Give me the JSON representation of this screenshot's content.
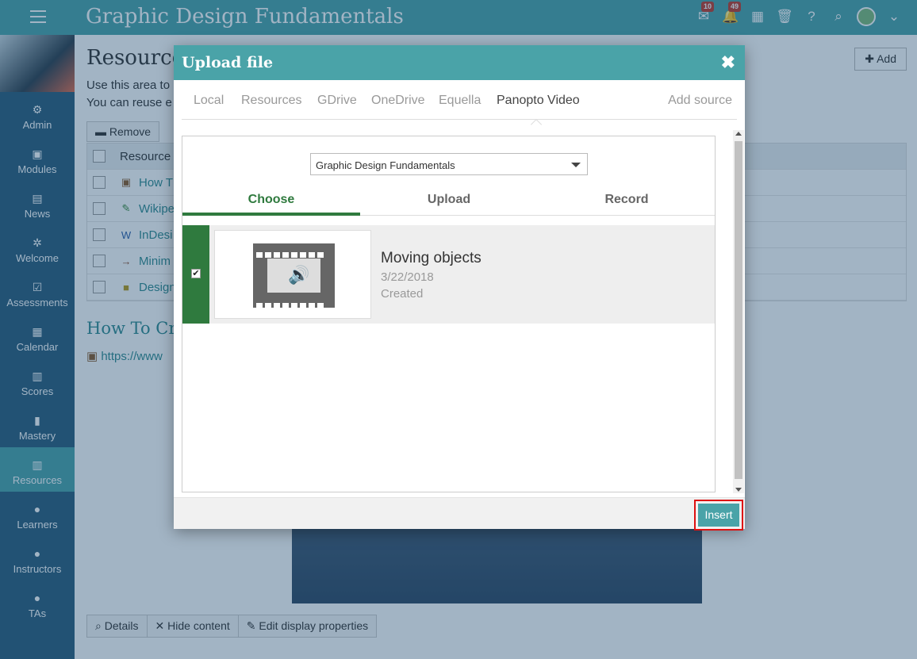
{
  "app": {
    "title": "Graphic Design Fundamentals"
  },
  "topbar": {
    "menu_icon": "hamburger-icon",
    "messages_badge": "10",
    "notifications_badge": "49",
    "icons": [
      "envelope-icon",
      "bell-icon",
      "calendar-icon",
      "trash-icon",
      "help-icon",
      "search-icon",
      "avatar",
      "chevron-down-icon"
    ]
  },
  "sidebar": {
    "items": [
      {
        "label": "Admin",
        "icon": "gear-icon"
      },
      {
        "label": "Modules",
        "icon": "book-icon"
      },
      {
        "label": "News",
        "icon": "news-icon"
      },
      {
        "label": "Welcome",
        "icon": "spinner-icon"
      },
      {
        "label": "Assessments",
        "icon": "check-icon"
      },
      {
        "label": "Calendar",
        "icon": "calendar-icon"
      },
      {
        "label": "Scores",
        "icon": "scores-icon"
      },
      {
        "label": "Mastery",
        "icon": "bar-chart-icon"
      },
      {
        "label": "Resources",
        "icon": "books-icon"
      },
      {
        "label": "Learners",
        "icon": "user-icon"
      },
      {
        "label": "Instructors",
        "icon": "user-icon"
      },
      {
        "label": "TAs",
        "icon": "user-icon"
      }
    ]
  },
  "page": {
    "title": "Resource",
    "desc1": "Use this area to",
    "desc2": "You can reuse e",
    "add_label": "Add",
    "remove_label": "Remove",
    "table_header": "Resource",
    "rows": [
      "How T",
      "Wikipe",
      "InDesi",
      "Minim",
      "Design"
    ],
    "section_title": "How To Cre",
    "url_text": "https://www",
    "toolbar": {
      "details": "Details",
      "hide": "Hide content",
      "edit": "Edit display properties"
    }
  },
  "modal": {
    "title": "Upload file",
    "close": "✖",
    "sources": [
      "Local",
      "Resources",
      "GDrive",
      "OneDrive",
      "Equella",
      "Panopto Video"
    ],
    "active_source": "Panopto Video",
    "add_source": "Add source",
    "folder_select": "Graphic Design Fundamentals",
    "sub_tabs": [
      "Choose",
      "Upload",
      "Record"
    ],
    "active_sub_tab": "Choose",
    "item": {
      "name": "Moving objects",
      "date": "3/22/2018",
      "status": "Created",
      "selected": true
    },
    "insert_label": "Insert"
  },
  "colors": {
    "accent": "#4aa3a8",
    "sidebar": "#2a5c7a",
    "selected": "#2f7a3e",
    "highlight": "#dd1111"
  }
}
